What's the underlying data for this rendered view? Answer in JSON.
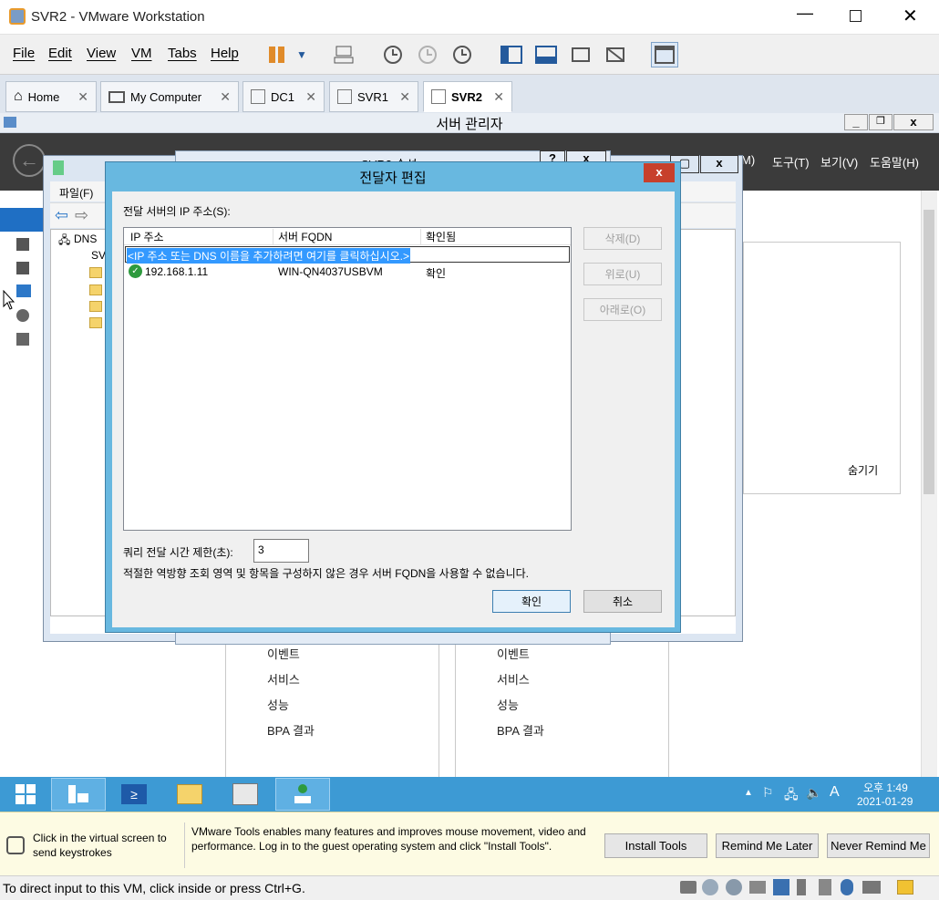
{
  "vmware": {
    "title": "SVR2 - VMware Workstation",
    "menu": {
      "file": "File",
      "edit": "Edit",
      "view": "View",
      "vm": "VM",
      "tabs": "Tabs",
      "help": "Help"
    },
    "tabs": [
      {
        "label": "Home"
      },
      {
        "label": "My Computer"
      },
      {
        "label": "DC1"
      },
      {
        "label": "SVR1"
      },
      {
        "label": "SVR2"
      }
    ],
    "notification": {
      "left_text": "Click in the virtual screen to send keystrokes",
      "message": "VMware Tools enables many features and improves mouse movement, video and performance. Log in to the guest operating system and click \"Install Tools\".",
      "install": "Install Tools",
      "remind": "Remind Me Later",
      "never": "Never Remind Me"
    },
    "status": "To direct input to this VM, click inside or press Ctrl+G."
  },
  "server_manager": {
    "title": "서버 관리자",
    "menu_suffix": "M)",
    "tools": "도구(T)",
    "view": "보기(V)",
    "help": "도움말(H)",
    "hide": "숨기기",
    "col1": [
      "이벤트",
      "서비스",
      "성능",
      "BPA 결과"
    ],
    "col2": [
      "이벤트",
      "서비스",
      "성능",
      "BPA 결과"
    ]
  },
  "dns_manager": {
    "file_menu": "파일(F)",
    "tree_root": "DNS",
    "tree_server": "SV"
  },
  "props_dialog": {
    "title": "SVR2 속성"
  },
  "forwarder_dialog": {
    "title": "전달자 편집",
    "ip_label": "전달 서버의 IP 주소(S):",
    "columns": {
      "ip": "IP 주소",
      "fqdn": "서버 FQDN",
      "verified": "확인됨"
    },
    "add_hint": "<IP 주소 또는 DNS 이름을 추가하려면 여기를 클릭하십시오.>",
    "rows": [
      {
        "ip": "192.168.1.11",
        "fqdn": "WIN-QN4037USBVM",
        "verified": "확인"
      }
    ],
    "delete": "삭제(D)",
    "up": "위로(U)",
    "down": "아래로(O)",
    "timeout_label": "쿼리 전달 시간 제한(초):",
    "timeout_value": "3",
    "note": "적절한 역방향 조회 영역 및 항목을 구성하지 않은 경우 서버 FQDN을 사용할 수 없습니다.",
    "ok": "확인",
    "cancel": "취소"
  },
  "taskbar": {
    "time": "오후 1:49",
    "date": "2021-01-29"
  }
}
